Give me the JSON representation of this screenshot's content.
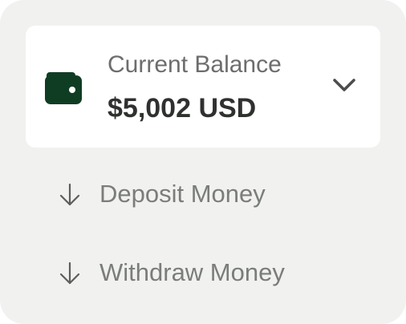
{
  "balance": {
    "label": "Current Balance",
    "amount": "$5,002 USD"
  },
  "actions": [
    {
      "label": "Deposit Money",
      "icon": "arrow-down-icon"
    },
    {
      "label": "Withdraw Money",
      "icon": "arrow-down-icon"
    }
  ],
  "icons": {
    "wallet": "wallet-icon",
    "toggle": "chevron-down-icon"
  },
  "colors": {
    "panel_bg": "#f1f2ef",
    "card_bg": "#ffffff",
    "wallet": "#0f3d24",
    "amount_text": "#2f312f",
    "muted_text": "#7a7d7a"
  }
}
